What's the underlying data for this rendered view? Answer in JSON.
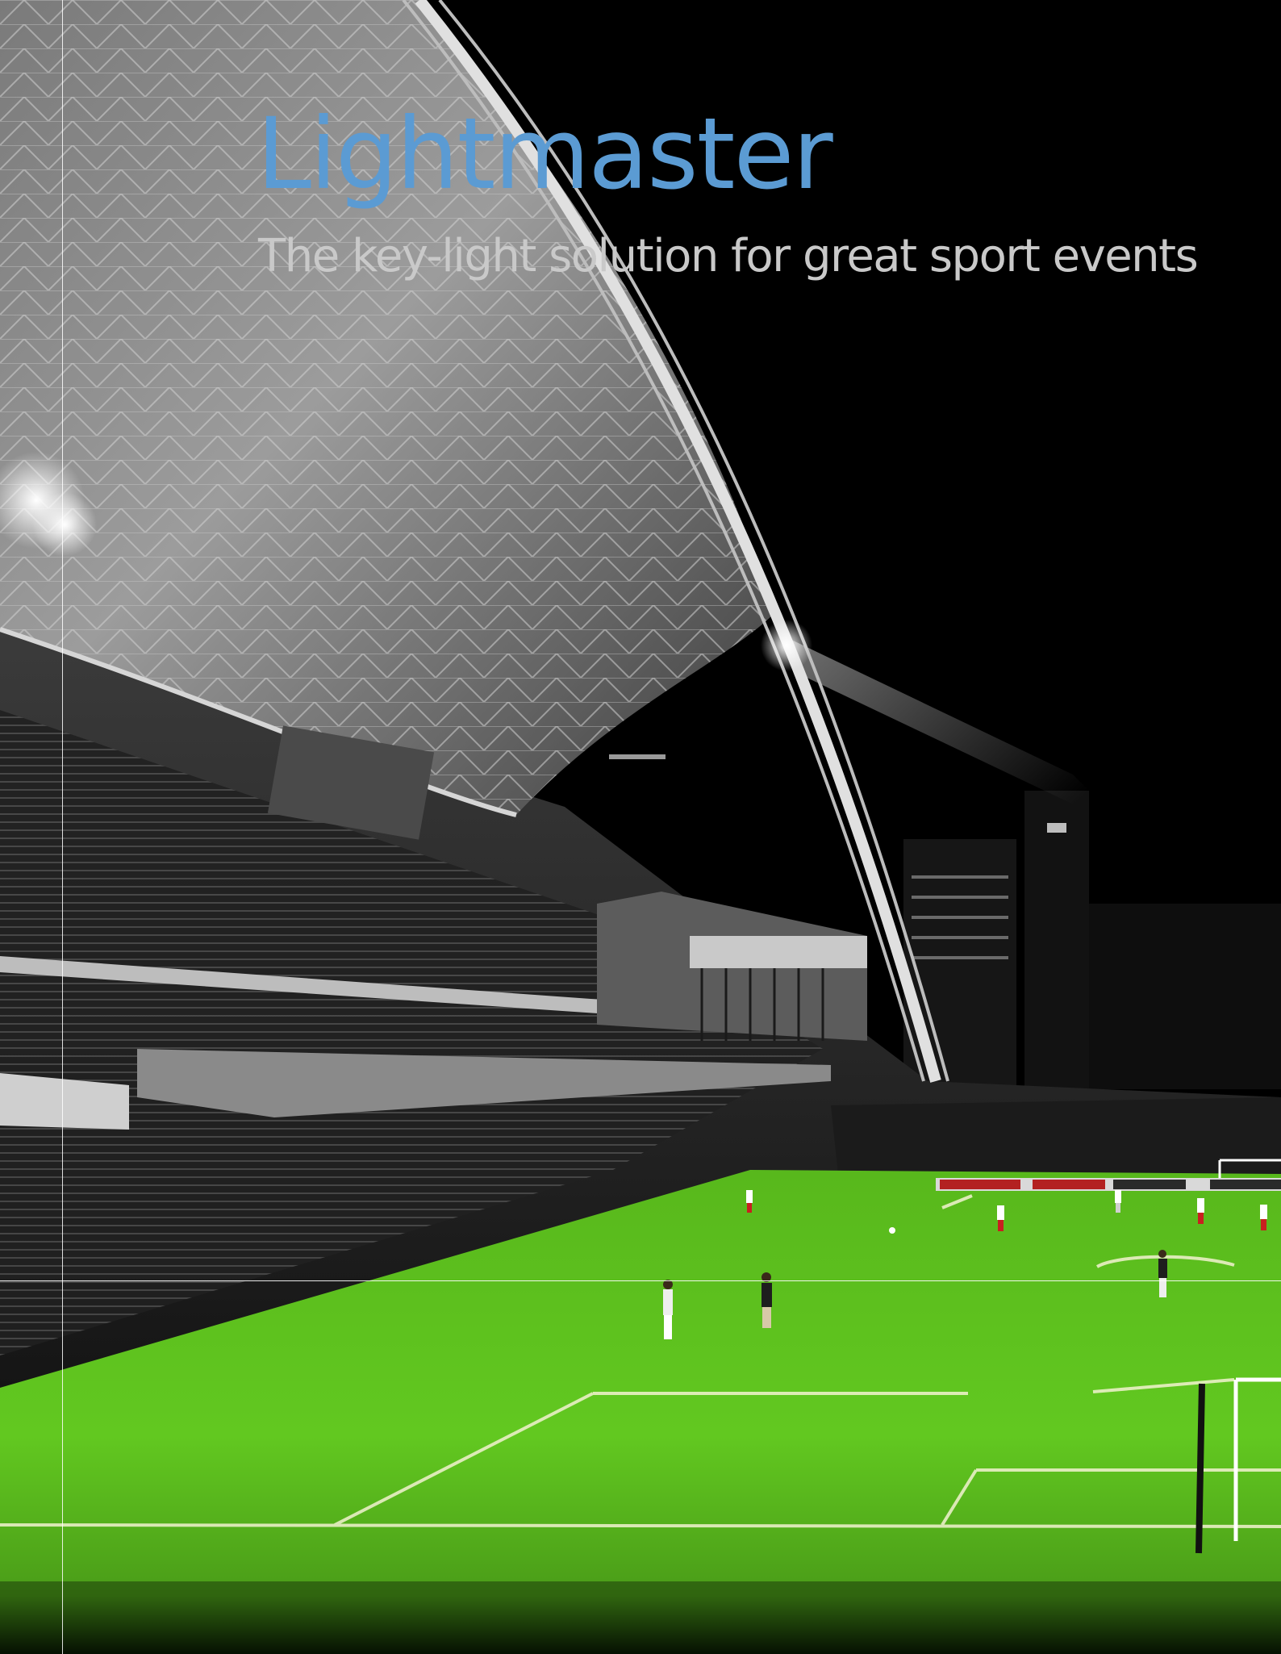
{
  "title": "Lightmaster",
  "subtitle": "The key-light solution for great sport events",
  "colors": {
    "title": "#5b9bd3",
    "subtitle": "#c9c9c9",
    "background": "#000000",
    "pitch": "#5cc21f",
    "pitch_dark": "#3d8f13"
  }
}
